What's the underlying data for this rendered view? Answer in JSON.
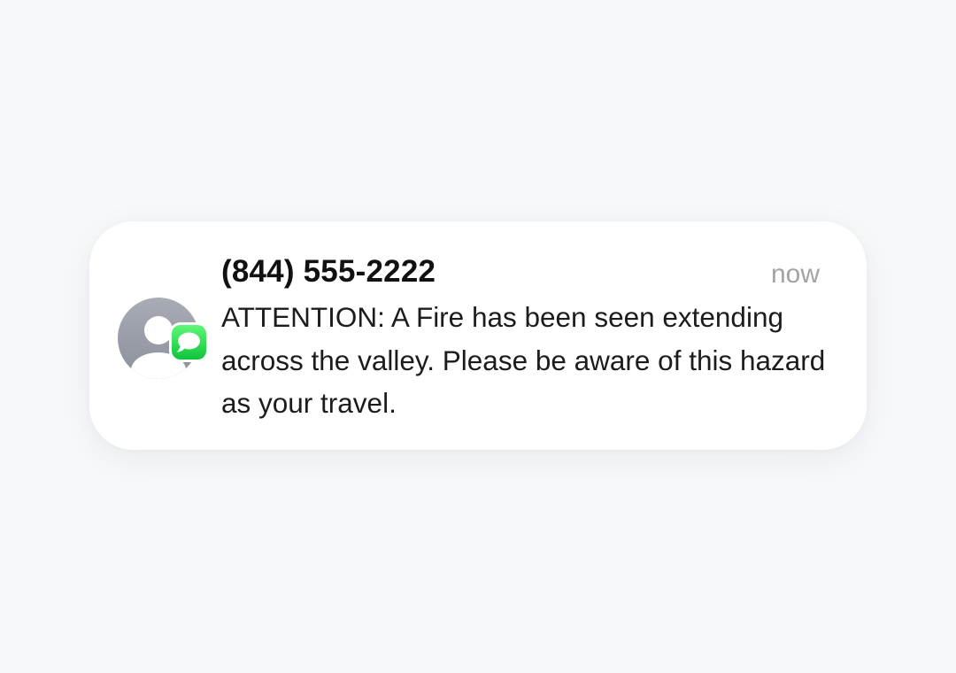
{
  "notification": {
    "sender": "(844) 555-2222",
    "timestamp": "now",
    "message": "ATTENTION: A Fire has been seen extending across the valley. Please be aware of this hazard as your travel.",
    "avatar_icon": "contact-placeholder-icon",
    "app_icon": "messages-app-icon",
    "app_badge_color": "#22d24a",
    "avatar_color": "#9a9da7"
  }
}
